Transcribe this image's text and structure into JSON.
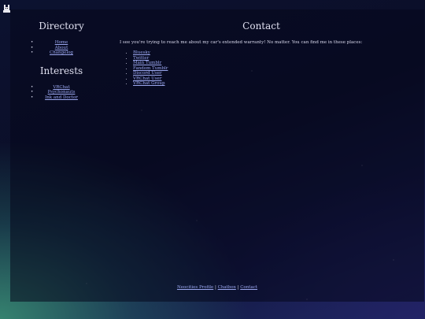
{
  "directory": {
    "title": "Directory",
    "items": [
      "Home",
      "About",
      "Changelog"
    ]
  },
  "interests": {
    "title": "Interests",
    "items": [
      "VRChat",
      "Psychonauts",
      "Ink and Doctor"
    ]
  },
  "contact": {
    "title": "Contact",
    "intro": "I see you're trying to reach me about my car's extended warranty! No matter. You can find me in these places:",
    "links": [
      "Bluesky",
      "Twitter",
      "Main Tumblr",
      "Fandom Tumblr",
      "Discord User",
      "VRChat User",
      "VRChat Group"
    ]
  },
  "footer": {
    "links": [
      "Neocities Profile",
      "Chatbox",
      "Contact"
    ],
    "separator": " | "
  }
}
